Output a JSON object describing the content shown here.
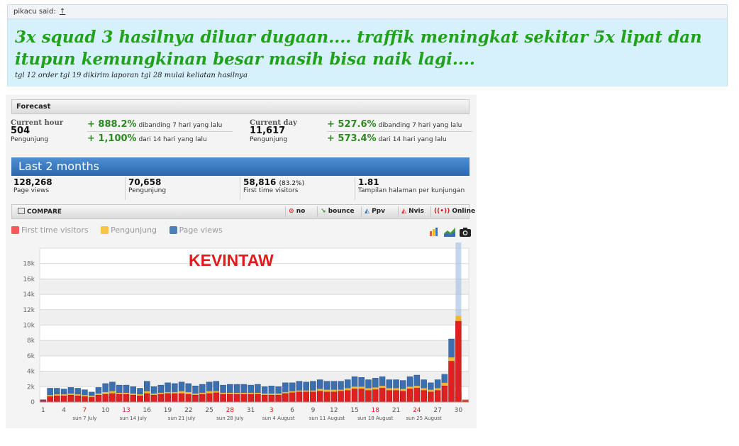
{
  "post": {
    "author_label": "pikacu said:",
    "up_link": "↑",
    "headline": "3x squad 3 hasilnya diluar dugaan.... traffik meningkat sekitar 5x lipat dan itupun kemungkinan besar masih bisa naik lagi....",
    "note": "tgl 12 order tgl 19 dikirim laporan tgl 28 mulai keliatan hasilnya"
  },
  "forecast": {
    "title": "Forecast",
    "current_hour": {
      "label": "Current hour",
      "value": "504",
      "unit": "Pengunjung"
    },
    "current_day": {
      "label": "Current day",
      "value": "11,617",
      "unit": "Pengunjung"
    },
    "hour_compare": [
      {
        "pct": "+ 888.2%",
        "text": "dibanding 7 hari yang lalu"
      },
      {
        "pct": "+ 1,100%",
        "text": "dari 14 hari yang lalu"
      }
    ],
    "day_compare": [
      {
        "pct": "+ 527.6%",
        "text": "dibanding 7 hari yang lalu"
      },
      {
        "pct": "+ 573.4%",
        "text": "dari 14 hari yang lalu"
      }
    ]
  },
  "period": {
    "title": "Last 2 months"
  },
  "stats": [
    {
      "value": "128,268",
      "extra": "",
      "label": "Page views"
    },
    {
      "value": "70,658",
      "extra": "",
      "label": "Pengunjung"
    },
    {
      "value": "58,816",
      "extra": "(83.2%)",
      "label": "First time visitors"
    },
    {
      "value": "1.81",
      "extra": "",
      "label": "Tampilan halaman per kunjungan"
    }
  ],
  "compare": {
    "label": "COMPARE",
    "buttons": [
      {
        "label": "no",
        "icon": "no-icon"
      },
      {
        "label": "bounce",
        "icon": "bounce-icon"
      },
      {
        "label": "Ppv",
        "icon": "ppv-icon"
      },
      {
        "label": "Nvis",
        "icon": "nvis-icon"
      },
      {
        "label": "Online",
        "icon": "online-icon"
      }
    ]
  },
  "legend": [
    {
      "label": "First time visitors",
      "color": "#f05a5a"
    },
    {
      "label": "Pengunjung",
      "color": "#f7c445"
    },
    {
      "label": "Page views",
      "color": "#4f7fb8"
    }
  ],
  "watermark": "KEVINTAW",
  "colors": {
    "green": "#22a11b",
    "blue_bar": "#2f6db3",
    "red": "#e11b1b"
  },
  "chart_data": {
    "type": "bar",
    "ylim": [
      0,
      20000
    ],
    "yticks": [
      0,
      2000,
      4000,
      6000,
      8000,
      10000,
      12000,
      14000,
      16000,
      18000
    ],
    "ytick_labels": [
      "0",
      "2k",
      "4k",
      "6k",
      "8k",
      "10k",
      "12k",
      "14k",
      "16k",
      "18k"
    ],
    "xtick_labels": [
      {
        "day": 1,
        "label": "1",
        "red": false
      },
      {
        "day": 4,
        "label": "4",
        "red": false
      },
      {
        "day": 7,
        "label": "7",
        "red": true
      },
      {
        "day": 10,
        "label": "10",
        "red": false
      },
      {
        "day": 13,
        "label": "13",
        "red": true
      },
      {
        "day": 16,
        "label": "16",
        "red": false
      },
      {
        "day": 19,
        "label": "19",
        "red": false
      },
      {
        "day": 22,
        "label": "22",
        "red": false
      },
      {
        "day": 25,
        "label": "25",
        "red": false
      },
      {
        "day": 28,
        "label": "28",
        "red": true
      },
      {
        "day": 31,
        "label": "31",
        "red": false
      },
      {
        "day": 34,
        "label": "3",
        "red": true
      },
      {
        "day": 37,
        "label": "6",
        "red": false
      },
      {
        "day": 40,
        "label": "9",
        "red": false
      },
      {
        "day": 43,
        "label": "12",
        "red": false
      },
      {
        "day": 46,
        "label": "15",
        "red": false
      },
      {
        "day": 49,
        "label": "18",
        "red": true
      },
      {
        "day": 52,
        "label": "21",
        "red": false
      },
      {
        "day": 55,
        "label": "24",
        "red": true
      },
      {
        "day": 58,
        "label": "27",
        "red": false
      },
      {
        "day": 61,
        "label": "30",
        "red": false
      }
    ],
    "week_labels": [
      {
        "day": 7,
        "label": "sun 7 July"
      },
      {
        "day": 14,
        "label": "sun 14 July"
      },
      {
        "day": 21,
        "label": "sun 21 July"
      },
      {
        "day": 28,
        "label": "sun 28 July"
      },
      {
        "day": 35,
        "label": "sun 4 August"
      },
      {
        "day": 42,
        "label": "sun 11 August"
      },
      {
        "day": 49,
        "label": "sun 18 August"
      },
      {
        "day": 56,
        "label": "sun 25 August"
      }
    ],
    "x": [
      1,
      2,
      3,
      4,
      5,
      6,
      7,
      8,
      9,
      10,
      11,
      12,
      13,
      14,
      15,
      16,
      17,
      18,
      19,
      20,
      21,
      22,
      23,
      24,
      25,
      26,
      27,
      28,
      29,
      30,
      31,
      32,
      33,
      34,
      35,
      36,
      37,
      38,
      39,
      40,
      41,
      42,
      43,
      44,
      45,
      46,
      47,
      48,
      49,
      50,
      51,
      52,
      53,
      54,
      55,
      56,
      57,
      58,
      59,
      60,
      61,
      62
    ],
    "series": [
      {
        "name": "Page views",
        "values": [
          300,
          1800,
          1800,
          1700,
          1900,
          1800,
          1600,
          1300,
          1900,
          2400,
          2600,
          2200,
          2200,
          2000,
          1800,
          2700,
          2000,
          2200,
          2500,
          2400,
          2600,
          2400,
          2100,
          2300,
          2600,
          2700,
          2200,
          2300,
          2300,
          2300,
          2200,
          2300,
          2000,
          2100,
          2000,
          2500,
          2500,
          2700,
          2600,
          2700,
          2900,
          2700,
          2700,
          2700,
          2900,
          3300,
          3200,
          2900,
          3100,
          3300,
          2900,
          2900,
          2800,
          3300,
          3500,
          2900,
          2500,
          2900,
          3600,
          8200,
          1200,
          300
        ]
      },
      {
        "name": "Pengunjung",
        "values": [
          200,
          900,
          1000,
          1000,
          1100,
          1000,
          900,
          800,
          1100,
          1300,
          1400,
          1200,
          1200,
          1100,
          1000,
          1400,
          1100,
          1200,
          1300,
          1300,
          1400,
          1300,
          1100,
          1200,
          1400,
          1400,
          1200,
          1200,
          1200,
          1200,
          1200,
          1200,
          1100,
          1100,
          1100,
          1300,
          1400,
          1500,
          1500,
          1500,
          1700,
          1600,
          1600,
          1600,
          1800,
          2000,
          2000,
          1800,
          1900,
          2100,
          1800,
          1800,
          1700,
          2000,
          2100,
          1800,
          1600,
          1800,
          2500,
          5800,
          11200,
          300
        ]
      },
      {
        "name": "First time visitors",
        "values": [
          200,
          700,
          800,
          800,
          900,
          800,
          700,
          600,
          900,
          1000,
          1100,
          1000,
          1000,
          900,
          800,
          1100,
          900,
          1000,
          1100,
          1100,
          1100,
          1000,
          900,
          1000,
          1100,
          1200,
          1000,
          1000,
          1000,
          1000,
          1000,
          1000,
          900,
          900,
          900,
          1100,
          1200,
          1300,
          1300,
          1300,
          1400,
          1300,
          1300,
          1400,
          1500,
          1700,
          1700,
          1500,
          1600,
          1800,
          1500,
          1500,
          1400,
          1700,
          1800,
          1500,
          1300,
          1500,
          2100,
          5300,
          10500,
          200
        ]
      }
    ]
  }
}
